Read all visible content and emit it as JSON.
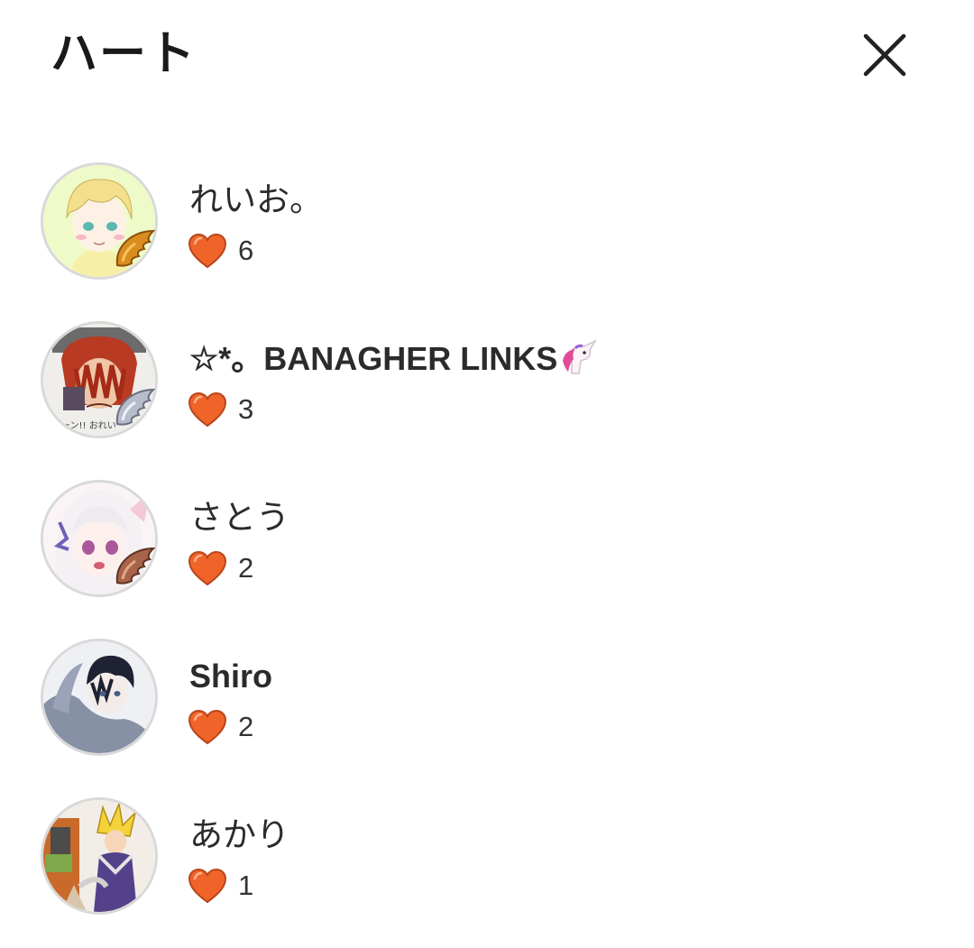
{
  "header": {
    "title": "ハート"
  },
  "list": {
    "items": [
      {
        "name": "れいお。",
        "hearts": "6",
        "avatar": "blonde-anime-avatar",
        "badge": "gold-wing-badge"
      },
      {
        "name": "☆*。BANAGHER LINKS",
        "hearts": "3",
        "avatar": "red-hair-drawing-avatar",
        "badge": "silver-wing-badge",
        "emoji": "unicorn-emoji"
      },
      {
        "name": "さとう",
        "hearts": "2",
        "avatar": "white-hair-anime-avatar",
        "badge": "bronze-wing-badge"
      },
      {
        "name": "Shiro",
        "hearts": "2",
        "avatar": "dark-hair-anime-avatar"
      },
      {
        "name": "あかり",
        "hearts": "1",
        "avatar": "blonde-warrior-avatar"
      }
    ]
  },
  "colors": {
    "heart": "#f0642a",
    "heart_outline": "#b8461a",
    "avatar_border": "#d9d9d9",
    "text": "#2b2b2b"
  }
}
